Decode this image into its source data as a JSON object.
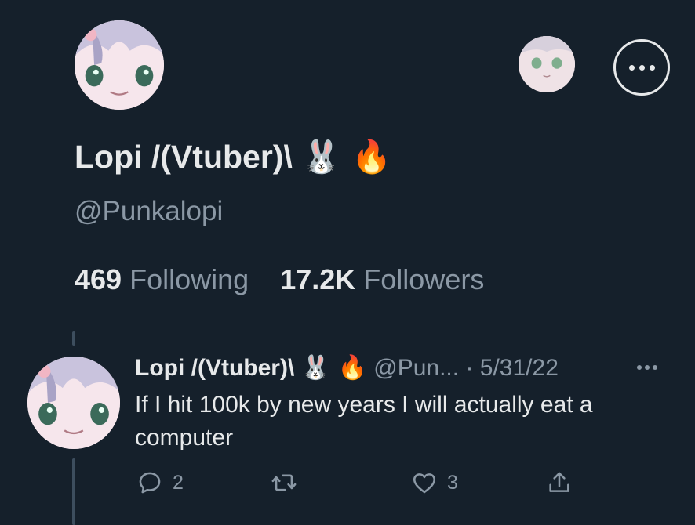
{
  "profile": {
    "display_name": "Lopi /(Vtuber)\\",
    "display_emoji": "🐰 🔥",
    "handle": "@Punkalopi",
    "following_count": "469",
    "following_label": "Following",
    "followers_count": "17.2K",
    "followers_label": "Followers"
  },
  "tweet": {
    "author_name": "Lopi /(Vtuber)\\",
    "author_emoji": "🐰 🔥",
    "handle": "@Pun...",
    "separator": "·",
    "date": "5/31/22",
    "text": "If I hit 100k by new years I will actually eat a computer",
    "reply_count": "2",
    "like_count": "3"
  },
  "icons": {
    "reply": "reply-icon",
    "retweet": "retweet-icon",
    "like": "heart-icon",
    "share": "share-icon",
    "more": "more-icon"
  },
  "colors": {
    "background": "#15202b",
    "text_primary": "#e7e9ea",
    "text_secondary": "#8b98a5"
  }
}
